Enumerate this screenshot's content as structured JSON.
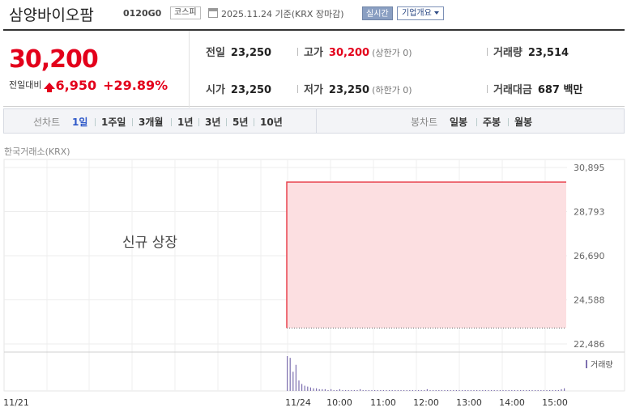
{
  "header": {
    "stock_name": "삼양바이오팜",
    "stock_code": "0120G0",
    "market": "코스피",
    "date_text": "2025.11.24 기준(KRX 장마감)",
    "realtime_label": "실시간",
    "company_overview_label": "기업개요"
  },
  "quote": {
    "price": "30,200",
    "change_label": "전일대비",
    "change": "6,950",
    "change_pct": "+29.89%",
    "direction": "up"
  },
  "stats": {
    "prev_close_label": "전일",
    "prev_close": "23,250",
    "open_label": "시가",
    "open": "23,250",
    "high_label": "고가",
    "high": "30,200",
    "high_note": "(상한가 0)",
    "low_label": "저가",
    "low": "23,250",
    "low_note": "(하한가 0)",
    "volume_label": "거래량",
    "volume": "23,514",
    "amount_label": "거래대금",
    "amount": "687 백만"
  },
  "tabs": {
    "line_label": "선차트",
    "line_periods": [
      "1일",
      "1주일",
      "3개월",
      "1년",
      "3년",
      "5년",
      "10년"
    ],
    "active_period": "1일",
    "candle_label": "봉차트",
    "candle_periods": [
      "일봉",
      "주봉",
      "월봉"
    ]
  },
  "chart_source": "한국거래소(KRX)",
  "colors": {
    "up": "#e3001b",
    "accent": "#2f59c9",
    "volume": "#7d6fb0"
  },
  "chart_data": {
    "type": "area",
    "annotation": "신규 상장",
    "y_ticks": [
      "30,895",
      "28,793",
      "26,690",
      "24,588",
      "22,486"
    ],
    "ylim": [
      22486,
      30895
    ],
    "x_ticks": [
      "11/21",
      "11/24",
      "10:00",
      "11:00",
      "12:00",
      "13:00",
      "14:00",
      "15:00"
    ],
    "series": [
      {
        "values": [
          [
            0,
            23250
          ],
          [
            0,
            30200
          ],
          [
            1,
            30200
          ]
        ]
      }
    ],
    "volume_label": "거래량",
    "volume_bars": [
      40,
      38,
      22,
      30,
      12,
      8,
      6,
      5,
      4,
      3,
      3,
      2,
      2,
      2,
      1,
      2,
      1,
      1,
      2,
      1,
      1,
      1,
      1,
      1,
      1,
      2,
      1,
      1,
      1,
      1,
      1,
      1,
      1,
      1,
      1,
      1,
      1,
      1,
      1,
      1,
      1,
      1,
      1,
      1,
      1,
      1,
      1,
      1,
      2,
      1,
      1,
      1,
      1,
      1,
      1,
      1,
      1,
      1,
      1,
      1,
      1,
      1,
      1,
      1,
      1,
      1,
      1,
      1,
      1,
      1,
      1,
      1,
      1,
      1,
      1,
      1,
      1,
      1,
      1,
      1,
      1,
      1,
      1,
      1,
      1,
      1,
      1,
      1,
      1,
      1,
      1,
      1,
      1,
      1,
      2,
      3
    ],
    "grid": true
  }
}
